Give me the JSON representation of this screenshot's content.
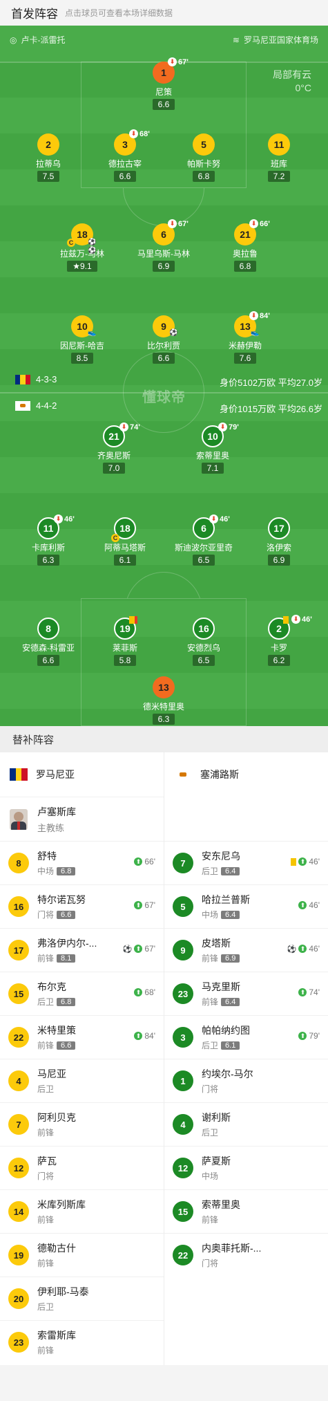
{
  "header": {
    "title": "首发阵容",
    "subtitle": "点击球员可查看本场详细数据"
  },
  "venue": {
    "home_coach": "卢卡-派雷托",
    "stadium": "罗马尼亚国家体育场"
  },
  "weather": {
    "desc": "局部有云",
    "temp": "0°C"
  },
  "watermark": "懂球帝",
  "home": {
    "formation": "4-3-3",
    "value": "身价5102万欧 平均27.0岁"
  },
  "away": {
    "formation": "4-4-2",
    "value": "身价1015万欧 平均26.6岁"
  },
  "colors": {
    "pitch": "#43a543",
    "yellow": "#fcca0b",
    "orange": "#f26b1f",
    "green": "#1c8a25"
  },
  "players_home": [
    {
      "num": "1",
      "name": "尼策",
      "rating": "6.6",
      "sub": "67'"
    },
    {
      "num": "2",
      "name": "拉蒂乌",
      "rating": "7.5",
      "sub": ""
    },
    {
      "num": "3",
      "name": "德拉古宰",
      "rating": "6.6",
      "sub": "68'"
    },
    {
      "num": "5",
      "name": "帕斯卡努",
      "rating": "6.8",
      "sub": ""
    },
    {
      "num": "11",
      "name": "班库",
      "rating": "7.2",
      "sub": ""
    },
    {
      "num": "18",
      "name": "拉兹万-马林",
      "rating": "9.1",
      "sub": ""
    },
    {
      "num": "6",
      "name": "马里乌斯-马林",
      "rating": "6.9",
      "sub": "67'"
    },
    {
      "num": "21",
      "name": "奥拉鲁",
      "rating": "6.8",
      "sub": "66'"
    },
    {
      "num": "10",
      "name": "因尼斯-哈吉",
      "rating": "8.5",
      "sub": ""
    },
    {
      "num": "9",
      "name": "比尔利贾",
      "rating": "6.6",
      "sub": ""
    },
    {
      "num": "13",
      "name": "米赫伊勒",
      "rating": "7.6",
      "sub": "84'"
    }
  ],
  "players_away": [
    {
      "num": "21",
      "name": "齐奥尼斯",
      "rating": "7.0",
      "sub": "74'"
    },
    {
      "num": "10",
      "name": "索蒂里奥",
      "rating": "7.1",
      "sub": "79'"
    },
    {
      "num": "11",
      "name": "卡库利斯",
      "rating": "6.3",
      "sub": "46'"
    },
    {
      "num": "18",
      "name": "阿蒂马塔斯",
      "rating": "6.1",
      "sub": ""
    },
    {
      "num": "6",
      "name": "斯迪波尔亚里奇",
      "rating": "6.5",
      "sub": "46'"
    },
    {
      "num": "17",
      "name": "洛伊索",
      "rating": "6.9",
      "sub": ""
    },
    {
      "num": "8",
      "name": "安德森-科雷亚",
      "rating": "6.6",
      "sub": ""
    },
    {
      "num": "19",
      "name": "莱菲斯",
      "rating": "5.8",
      "sub": ""
    },
    {
      "num": "16",
      "name": "安德烈乌",
      "rating": "6.5",
      "sub": ""
    },
    {
      "num": "2",
      "name": "卡罗",
      "rating": "6.2",
      "sub": "46'"
    },
    {
      "num": "13",
      "name": "德米特里奥",
      "rating": "6.3",
      "sub": ""
    }
  ],
  "bench": {
    "title": "替补阵容",
    "home_team": "罗马尼亚",
    "away_team": "塞浦路斯",
    "coach": {
      "name": "卢塞斯库",
      "role": "主教练"
    },
    "home": [
      {
        "num": "8",
        "name": "舒特",
        "pos": "中场",
        "rating": "6.8",
        "ev": "66'"
      },
      {
        "num": "16",
        "name": "特尔诺瓦努",
        "pos": "门将",
        "rating": "6.6",
        "ev": "67'"
      },
      {
        "num": "17",
        "name": "弗洛伊内尔-...",
        "pos": "前锋",
        "rating": "8.1",
        "ev": "67'"
      },
      {
        "num": "15",
        "name": "布尔克",
        "pos": "后卫",
        "rating": "6.8",
        "ev": "68'"
      },
      {
        "num": "22",
        "name": "米特里策",
        "pos": "前锋",
        "rating": "6.6",
        "ev": "84'"
      },
      {
        "num": "4",
        "name": "马尼亚",
        "pos": "后卫",
        "rating": "",
        "ev": ""
      },
      {
        "num": "7",
        "name": "阿利贝克",
        "pos": "前锋",
        "rating": "",
        "ev": ""
      },
      {
        "num": "12",
        "name": "萨瓦",
        "pos": "门将",
        "rating": "",
        "ev": ""
      },
      {
        "num": "14",
        "name": "米库列斯库",
        "pos": "前锋",
        "rating": "",
        "ev": ""
      },
      {
        "num": "19",
        "name": "德勒古什",
        "pos": "前锋",
        "rating": "",
        "ev": ""
      },
      {
        "num": "20",
        "name": "伊利耶-马泰",
        "pos": "后卫",
        "rating": "",
        "ev": ""
      },
      {
        "num": "23",
        "name": "索雷斯库",
        "pos": "前锋",
        "rating": "",
        "ev": ""
      }
    ],
    "away": [
      {
        "num": "7",
        "name": "安东尼乌",
        "pos": "后卫",
        "rating": "6.4",
        "ev": "46'"
      },
      {
        "num": "5",
        "name": "哈拉兰普斯",
        "pos": "中场",
        "rating": "6.4",
        "ev": "46'"
      },
      {
        "num": "9",
        "name": "皮塔斯",
        "pos": "前锋",
        "rating": "6.9",
        "ev": "46'"
      },
      {
        "num": "23",
        "name": "马克里斯",
        "pos": "前锋",
        "rating": "6.4",
        "ev": "74'"
      },
      {
        "num": "3",
        "name": "帕帕纳约图",
        "pos": "后卫",
        "rating": "6.1",
        "ev": "79'"
      },
      {
        "num": "1",
        "name": "约埃尔-马尔",
        "pos": "门将",
        "rating": "",
        "ev": ""
      },
      {
        "num": "4",
        "name": "谢利斯",
        "pos": "后卫",
        "rating": "",
        "ev": ""
      },
      {
        "num": "12",
        "name": "萨夏斯",
        "pos": "中场",
        "rating": "",
        "ev": ""
      },
      {
        "num": "15",
        "name": "索蒂里奥",
        "pos": "前锋",
        "rating": "",
        "ev": ""
      },
      {
        "num": "22",
        "name": "内奥菲托斯-...",
        "pos": "门将",
        "rating": "",
        "ev": ""
      }
    ]
  }
}
